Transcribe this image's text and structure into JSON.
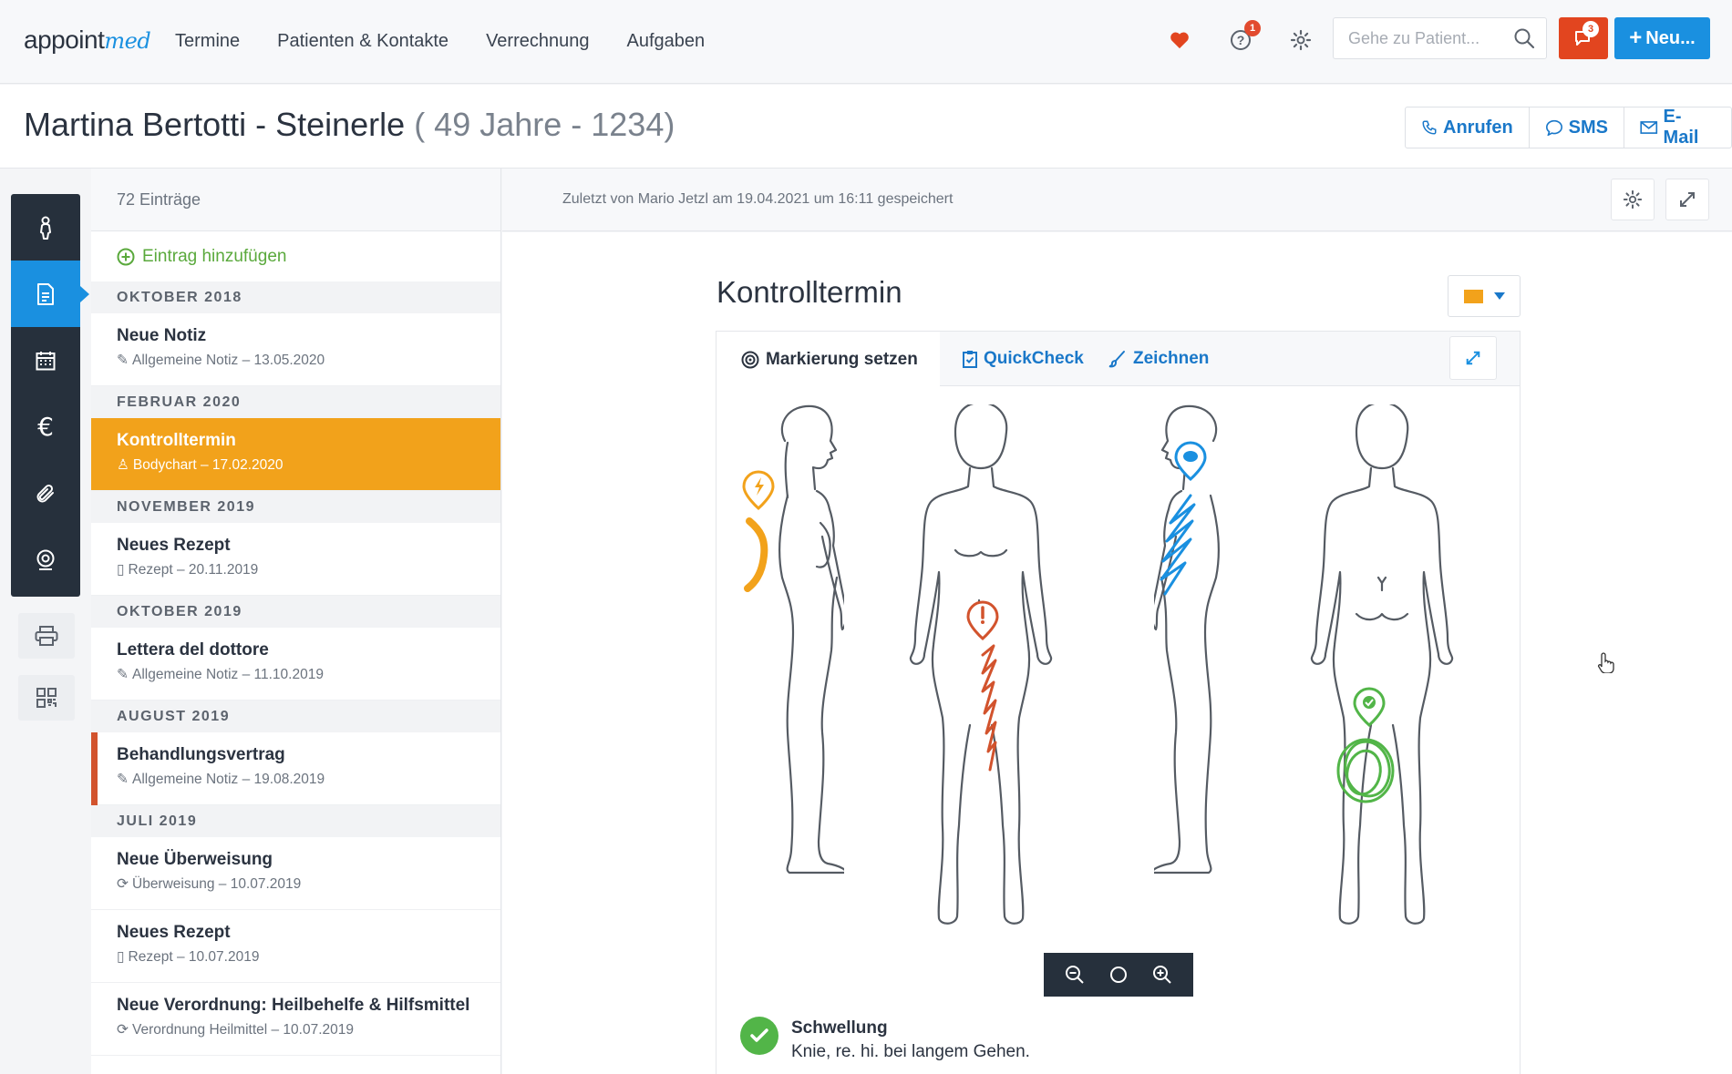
{
  "app": {
    "logo_main": "appoint",
    "logo_accent": "med"
  },
  "topnav": {
    "items": [
      "Termine",
      "Patienten & Kontakte",
      "Verrechnung",
      "Aufgaben"
    ]
  },
  "topbar": {
    "help_badge": "1",
    "search_placeholder": "Gehe zu Patient...",
    "notif_badge": "3",
    "new_label": "Neu..."
  },
  "patient": {
    "name": "Martina Bertotti - Steinerle",
    "meta": "( 49 Jahre - 1234)",
    "actions": {
      "call": "Anrufen",
      "sms": "SMS",
      "email": "E-Mail"
    }
  },
  "rail": {
    "items": [
      "bodychart-icon",
      "document-icon",
      "calendar-icon",
      "euro-icon",
      "paperclip-icon",
      "camera-icon"
    ],
    "extra": [
      "printer-icon",
      "qr-code-icon"
    ]
  },
  "entries": {
    "count": "72 Einträge",
    "add_label": "Eintrag hinzufügen",
    "groups": [
      {
        "month": "OKTOBER 2018",
        "items": [
          {
            "title": "Neue Notiz",
            "sub": "Allgemeine Notiz – 13.05.2020",
            "icon": "pencil-icon"
          }
        ]
      },
      {
        "month": "FEBRUAR 2020",
        "items": [
          {
            "title": "Kontrolltermin",
            "sub": "Bodychart – 17.02.2020",
            "icon": "bodychart-icon"
          }
        ]
      },
      {
        "month": "NOVEMBER 2019",
        "items": [
          {
            "title": "Neues Rezept",
            "sub": "Rezept – 20.11.2019",
            "icon": "clipboard-icon"
          }
        ]
      },
      {
        "month": "OKTOBER 2019",
        "items": [
          {
            "title": "Lettera del dottore",
            "sub": "Allgemeine Notiz – 11.10.2019",
            "icon": "pencil-icon"
          }
        ]
      },
      {
        "month": "AUGUST 2019",
        "items": [
          {
            "title": "Behandlungsvertrag",
            "sub": "Allgemeine Notiz – 19.08.2019",
            "icon": "pencil-icon"
          }
        ]
      },
      {
        "month": "JULI 2019",
        "items": [
          {
            "title": "Neue Überweisung",
            "sub": "Überweisung – 10.07.2019",
            "icon": "refresh-icon"
          },
          {
            "title": "Neues Rezept",
            "sub": "Rezept – 10.07.2019",
            "icon": "clipboard-icon"
          },
          {
            "title": "Neue Verordnung: Heilbehelfe & Hilfsmittel",
            "sub": "Verordnung Heilmittel – 10.07.2019",
            "icon": "refresh-icon"
          }
        ]
      }
    ]
  },
  "document": {
    "saved_note": "Zuletzt von Mario Jetzl am 19.04.2021 um 16:11 gespeichert",
    "title": "Kontrolltermin",
    "color": "#f2a21b",
    "tabs": {
      "mark": "Markierung setzen",
      "quickcheck": "QuickCheck",
      "draw": "Zeichnen"
    },
    "finding": {
      "title": "Schwellung",
      "detail": "Knie, re. hi. bei langem Gehen."
    }
  },
  "colors": {
    "primary": "#1a90e0",
    "accent_orange": "#f2a21b",
    "danger": "#e2451f",
    "success": "#52b548",
    "dark": "#26303c"
  }
}
